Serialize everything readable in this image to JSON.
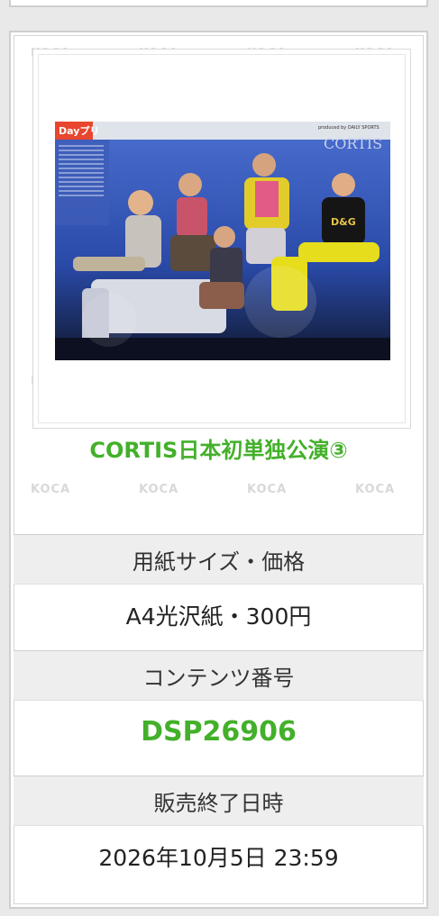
{
  "product": {
    "title": "CORTIS日本初単独公演③",
    "watermark": "KOCA"
  },
  "details": [
    {
      "label": "用紙サイズ・価格",
      "value": "A4光沢紙・300円"
    },
    {
      "label": "コンテンツ番号",
      "value": "DSP26906"
    },
    {
      "label": "販売終了日時",
      "value": "2026年10月5日 23:59"
    }
  ],
  "photo": {
    "newspaper_masthead": "Dayプリ",
    "headline": "CORTIS",
    "credit": "produced by DAILY SPORTS",
    "shirt_logo": "D&G"
  },
  "colors": {
    "accent_green": "#43b02a",
    "label_bg": "#eeeeee",
    "border": "#cfcfcf"
  }
}
